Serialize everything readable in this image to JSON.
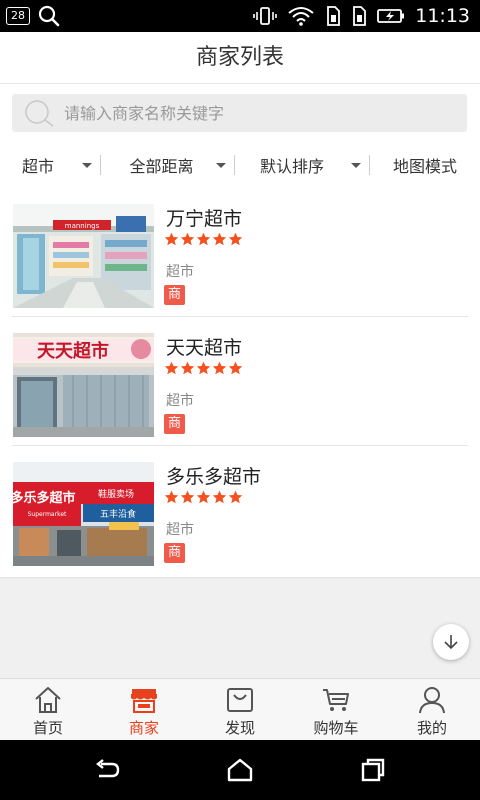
{
  "status_bar": {
    "notification_count": "28",
    "time": "11:13",
    "icons": [
      "search-icon",
      "vibrate-icon",
      "wifi-icon",
      "sim1-icon",
      "sim2-icon",
      "battery-charging-icon"
    ]
  },
  "header": {
    "title": "商家列表"
  },
  "search": {
    "placeholder": "请输入商家名称关键字",
    "value": ""
  },
  "filters": [
    {
      "label": "超市",
      "has_dropdown": true
    },
    {
      "label": "全部距离",
      "has_dropdown": true
    },
    {
      "label": "默认排序",
      "has_dropdown": true
    },
    {
      "label": "地图模式",
      "has_dropdown": false
    }
  ],
  "shops": [
    {
      "name": "万宁超市",
      "rating": 5,
      "category": "超市",
      "tag": "商"
    },
    {
      "name": "天天超市",
      "rating": 5,
      "category": "超市",
      "tag": "商"
    },
    {
      "name": "多乐多超市",
      "rating": 5,
      "category": "超市",
      "tag": "商"
    }
  ],
  "shop_photo_text": {
    "shop0": "mannings",
    "shop1": "天天超市",
    "shop2": "多乐多超市",
    "shop2_sub": "Supermarket",
    "shop2_sign": "鞋服卖场",
    "shop2_sign2": "五丰沿食"
  },
  "tabs": [
    {
      "label": "首页",
      "icon": "home-icon",
      "active": false
    },
    {
      "label": "商家",
      "icon": "store-icon",
      "active": true
    },
    {
      "label": "发现",
      "icon": "discover-icon",
      "active": false
    },
    {
      "label": "购物车",
      "icon": "cart-icon",
      "active": false
    },
    {
      "label": "我的",
      "icon": "user-icon",
      "active": false
    }
  ],
  "colors": {
    "accent": "#e8411e",
    "star": "#f4511e",
    "tag_bg": "#f05a4a"
  }
}
